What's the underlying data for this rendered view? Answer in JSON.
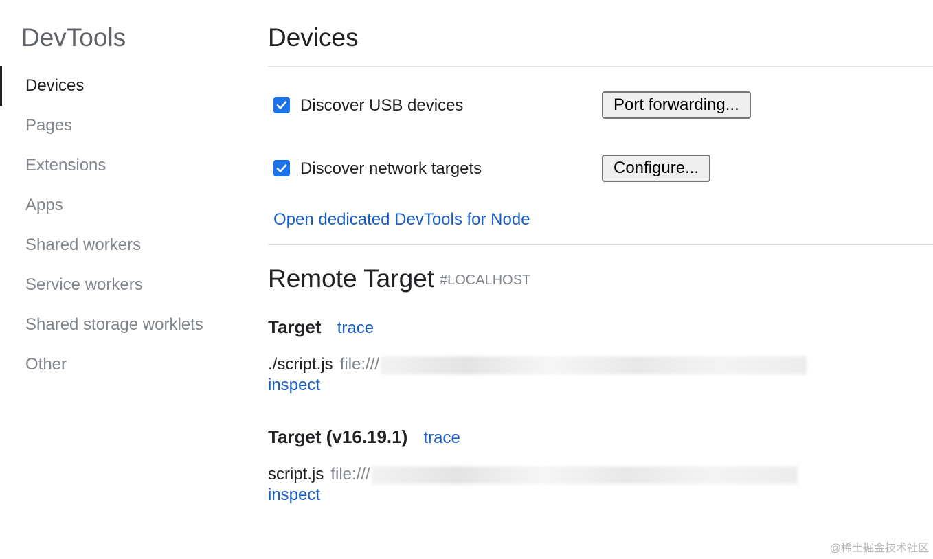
{
  "sidebar": {
    "title": "DevTools",
    "items": [
      {
        "label": "Devices"
      },
      {
        "label": "Pages"
      },
      {
        "label": "Extensions"
      },
      {
        "label": "Apps"
      },
      {
        "label": "Shared workers"
      },
      {
        "label": "Service workers"
      },
      {
        "label": "Shared storage worklets"
      },
      {
        "label": "Other"
      }
    ]
  },
  "main": {
    "title": "Devices",
    "usb": {
      "label": "Discover USB devices",
      "checked": true,
      "button": "Port forwarding..."
    },
    "network": {
      "label": "Discover network targets",
      "checked": true,
      "button": "Configure..."
    },
    "node_link": "Open dedicated DevTools for Node",
    "remote": {
      "title": "Remote Target",
      "tag": "#LOCALHOST",
      "targets": [
        {
          "name": "Target",
          "trace": "trace",
          "script": "./script.js",
          "url": "file:///",
          "inspect": "inspect"
        },
        {
          "name": "Target (v16.19.1)",
          "trace": "trace",
          "script": "script.js",
          "url": "file:///",
          "inspect": "inspect"
        }
      ]
    }
  },
  "watermark": "@稀土掘金技术社区",
  "colors": {
    "accent": "#1a73e8",
    "link": "#1a5fc7",
    "muted": "#80868b",
    "text": "#202124"
  }
}
